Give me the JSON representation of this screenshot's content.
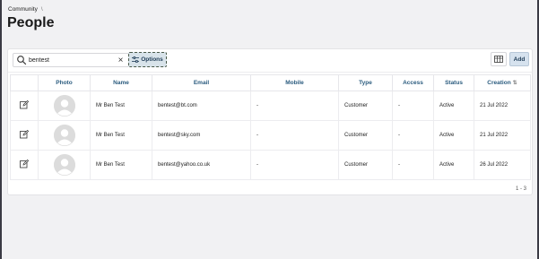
{
  "breadcrumb": {
    "items": [
      "Community"
    ],
    "separator": "\\"
  },
  "page": {
    "title": "People"
  },
  "toolbar": {
    "search_value": "bentest",
    "clear_label": "×",
    "options_label": "Options",
    "add_label": "Add"
  },
  "table": {
    "columns": [
      "Photo",
      "Name",
      "Email",
      "Mobile",
      "Type",
      "Access",
      "Status",
      "Creation"
    ],
    "rows": [
      {
        "name": "Mr Ben Test",
        "email": "bentest@bt.com",
        "mobile": "-",
        "type": "Customer",
        "access": "-",
        "status": "Active",
        "creation": "21 Jul 2022"
      },
      {
        "name": "Mr Ben Test",
        "email": "bentest@sky.com",
        "mobile": "-",
        "type": "Customer",
        "access": "-",
        "status": "Active",
        "creation": "21 Jul 2022"
      },
      {
        "name": "Mr Ben Test",
        "email": "bentest@yahoo.co.uk",
        "mobile": "-",
        "type": "Customer",
        "access": "-",
        "status": "Active",
        "creation": "26 Jul 2022"
      }
    ]
  },
  "pager": {
    "text": "1 - 3"
  },
  "icons": {
    "search": "search-icon",
    "clear": "close-icon",
    "options": "sliders-icon",
    "columns": "columns-icon",
    "edit": "edit-icon",
    "avatar": "avatar-placeholder",
    "sort": "sort-icon"
  },
  "colors": {
    "header_text": "#2a5b7e",
    "button_bg": "#d6e2ee",
    "background": "#f1f1f3"
  }
}
